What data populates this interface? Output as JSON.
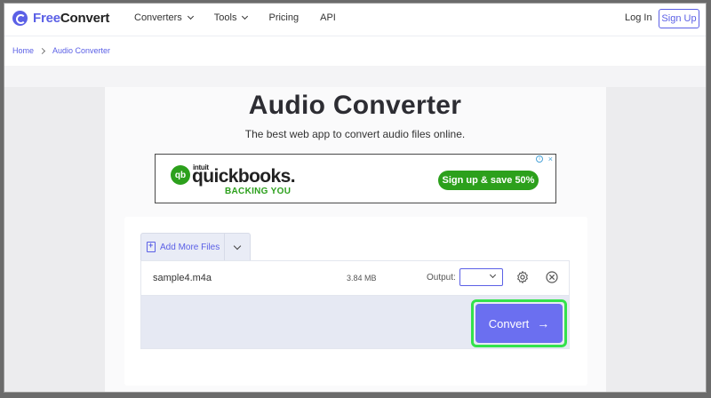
{
  "brand": {
    "free": "Free",
    "convert": "Convert"
  },
  "nav": {
    "items": [
      {
        "label": "Converters",
        "dropdown": true
      },
      {
        "label": "Tools",
        "dropdown": true
      },
      {
        "label": "Pricing",
        "dropdown": false
      },
      {
        "label": "API",
        "dropdown": false
      }
    ],
    "login": "Log In",
    "signup": "Sign Up"
  },
  "breadcrumb": {
    "home": "Home",
    "current": "Audio Converter"
  },
  "page": {
    "title": "Audio Converter",
    "subtitle": "The best web app to convert audio files online."
  },
  "ad": {
    "brand_prefix": "intuit",
    "brand": "quickbooks.",
    "tagline": "BACKING YOU",
    "cta": "Sign up & save 50%",
    "logo_letters": "qb",
    "info": "i",
    "close": "×"
  },
  "converter": {
    "add_files": "Add More Files",
    "file": {
      "name": "sample4.m4a",
      "size": "3.84 MB"
    },
    "output_label": "Output:",
    "output_value": "",
    "convert_label": "Convert",
    "convert_arrow": "→"
  },
  "colors": {
    "accent": "#5b60e6",
    "convert": "#6b6ff0",
    "highlight": "#33e24c",
    "ad_green": "#2ca01c"
  }
}
